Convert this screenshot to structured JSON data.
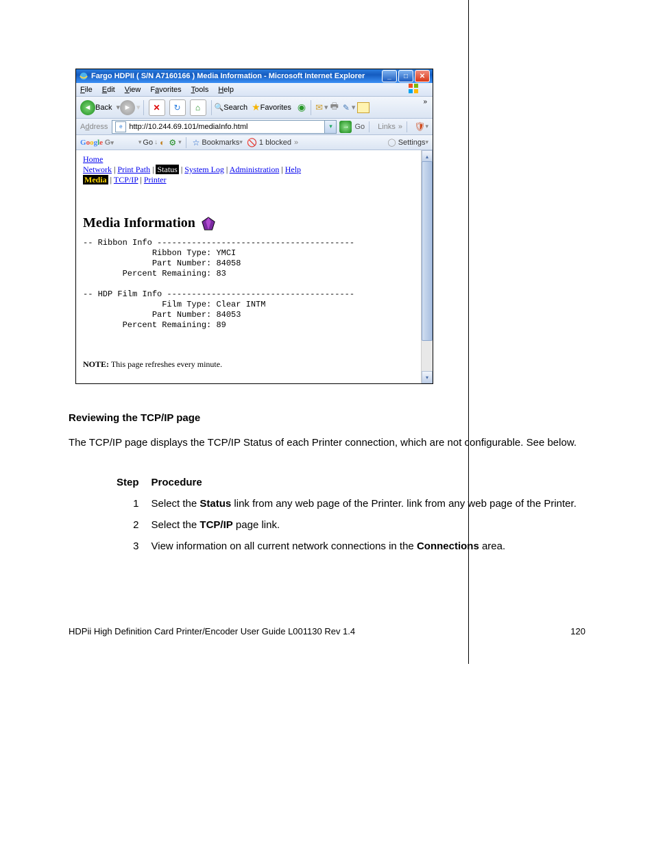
{
  "browser": {
    "title": "Fargo HDPII ( S/N A7160166 ) Media Information - Microsoft Internet Explorer",
    "menus": {
      "file": "File",
      "edit": "Edit",
      "view": "View",
      "favorites": "Favorites",
      "tools": "Tools",
      "help": "Help"
    },
    "toolbar": {
      "back": "Back",
      "search": "Search",
      "favorites": "Favorites"
    },
    "address": {
      "label": "Address",
      "url": "http://10.244.69.101/mediaInfo.html",
      "go": "Go",
      "links": "Links",
      "more": "»"
    },
    "google": {
      "go": "Go",
      "bookmarks": "Bookmarks",
      "blocked": "1 blocked",
      "settings": "Settings",
      "more": "»"
    }
  },
  "page": {
    "nav": {
      "home": "Home",
      "network": "Network",
      "printpath": "Print Path",
      "status": "Status",
      "syslog": "System Log",
      "admin": "Administration",
      "help": "Help",
      "media": "Media",
      "tcpip": "TCP/IP",
      "printer": "Printer"
    },
    "heading": "Media Information",
    "ribbon": {
      "section": "-- Ribbon Info ----------------------------------------",
      "type_label": "Ribbon Type:",
      "type_value": "YMCI",
      "part_label": "Part Number:",
      "part_value": "84058",
      "remain_label": "Percent Remaining:",
      "remain_value": "83"
    },
    "film": {
      "section": "-- HDP Film Info --------------------------------------",
      "type_label": "Film Type:",
      "type_value": "Clear INTM",
      "part_label": "Part Number:",
      "part_value": "84053",
      "remain_label": "Percent Remaining:",
      "remain_value": "89"
    },
    "note_label": "NOTE:",
    "note_text": "This page refreshes every minute."
  },
  "doc": {
    "heading": "Reviewing the TCP/IP page",
    "intro": "The TCP/IP page displays the TCP/IP Status of each Printer connection, which are not configurable. See below.",
    "col_step": "Step",
    "col_proc": "Procedure",
    "s1n": "1",
    "s1a": "Select the ",
    "s1b": "Status",
    " s1c": " link from any web page of the Printer.",
    "s2n": "2",
    "s2a": "Select the ",
    "s2b": "TCP/IP",
    "s2c": " page link.",
    "s3n": "3",
    "s3a": "View information on all current network connections in the ",
    "s3b": "Connections",
    "s3c": " area.",
    "footer_left": "HDPii High Definition Card Printer/Encoder User Guide    L001130 Rev 1.4",
    "footer_page": "120"
  }
}
